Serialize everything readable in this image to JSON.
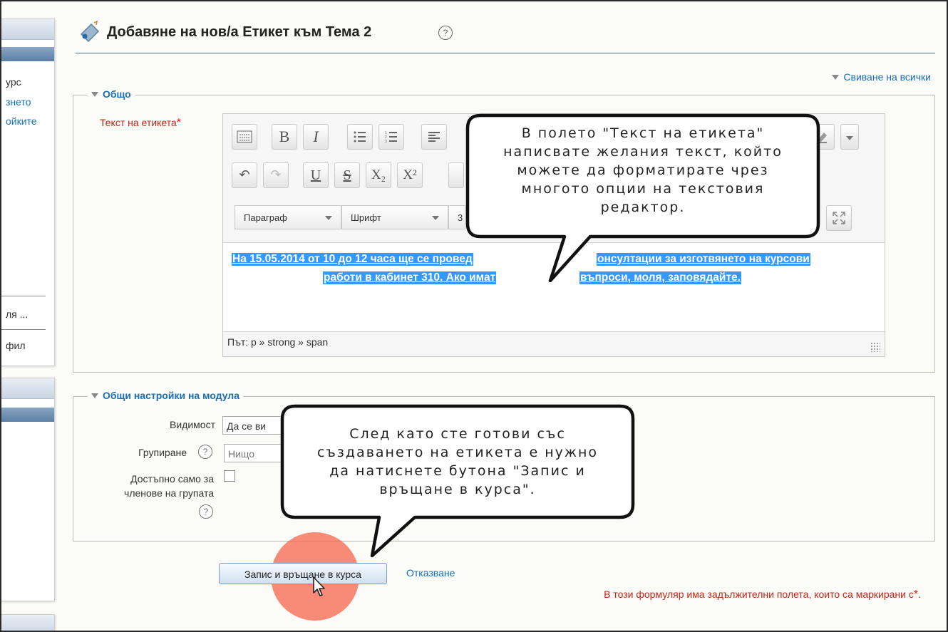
{
  "sidebar": {
    "block1_lines": [
      "урс",
      "знето",
      "ойките"
    ],
    "block1_lower": [
      "ля ...",
      "фил"
    ]
  },
  "page": {
    "title": "Добавяне на нов/а Етикет към Тема 2",
    "help_icon": "question-circle-icon",
    "collapse_all": "Свиване на всички"
  },
  "general": {
    "legend": "Общо",
    "label_text": "Текст на етикета",
    "required_star": "*"
  },
  "editor": {
    "toolbar_row1": [
      "toggle-toolbar-icon",
      "bold-icon",
      "italic-icon",
      "bullet-list-icon",
      "numbered-list-icon",
      "align-left-icon",
      "clear-format-icon",
      "more-icon"
    ],
    "bold_label": "B",
    "italic_label": "I",
    "toolbar_row2": [
      "undo-icon",
      "redo-icon",
      "underline-icon",
      "strikethrough-icon",
      "subscript-icon",
      "superscript-icon"
    ],
    "underline_label": "U",
    "strike_label": "S",
    "sub_label": "X₂",
    "sup_label": "X²",
    "paragraph_select": "Параграф",
    "font_select": "Шрифт",
    "size_partial": "3",
    "content_line1": "На 15.05.2014 от 10 до 12 часа ще се провед",
    "content_line1b": "онсултации за изготвянето на курсови",
    "content_line2": "работи в кабинет 310. Ако имат",
    "content_line2b": "въпроси, моля, заповядайте.",
    "path": "Път: p » strong » span"
  },
  "module_settings": {
    "legend": "Общи настройки на модула",
    "visibility_label": "Видимост",
    "visibility_value": "Да се ви",
    "grouping_label": "Групиране",
    "grouping_value": "Нищо",
    "group_only_label_1": "Достъпно само за",
    "group_only_label_2": "членове на групата"
  },
  "actions": {
    "save_return": "Запис и връщане в курса",
    "cancel": "Отказване",
    "required_note": "В този формуляр има задължителни полета, които са маркирани с",
    "required_note_star": "*",
    "required_note_end": "."
  },
  "callouts": {
    "top": [
      "В полето \"Текст на етикета\"",
      "написвате желания текст, който",
      "можете да форматирате чрез",
      "многото опции на текстовия",
      "редактор."
    ],
    "bottom": [
      "След като сте готови със",
      "създаването на етикета е нужно",
      "да натиснете бутона \"Запис и",
      "връщане в курса\"."
    ]
  },
  "colors": {
    "accent_link": "#1a6fb5",
    "required_red": "#c0271a",
    "selection_blue": "#3399ff",
    "click_highlight": "#f66046"
  }
}
